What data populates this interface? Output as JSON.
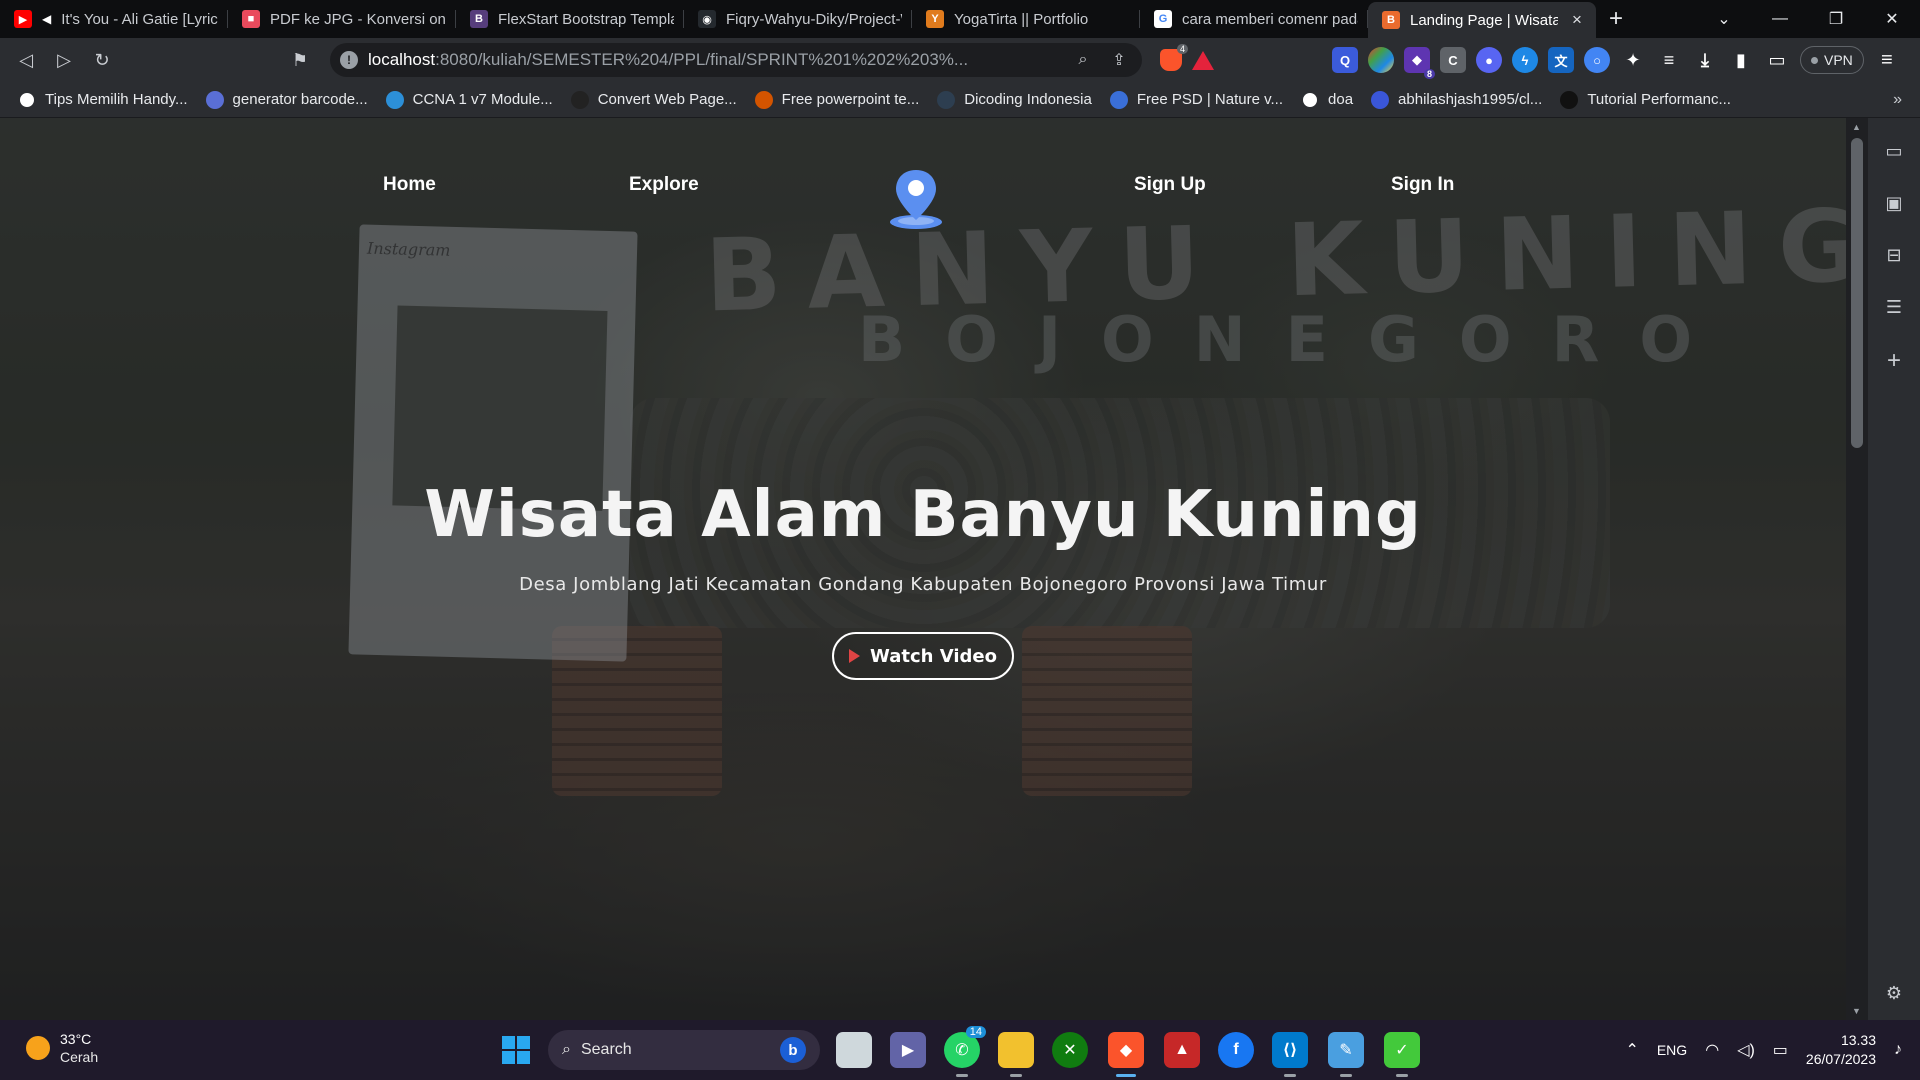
{
  "browser": {
    "tabs": [
      {
        "title": "It's You - Ali Gatie [Lyrics]",
        "favicon_color": "#ff0000",
        "favicon_glyph": "▶",
        "muted": true
      },
      {
        "title": "PDF ke JPG - Konversi online",
        "favicon_color": "#e94a5c",
        "favicon_glyph": "■"
      },
      {
        "title": "FlexStart Bootstrap Template",
        "favicon_color": "#563d7c",
        "favicon_glyph": "B"
      },
      {
        "title": "Fiqry-Wahyu-Diky/Project-W",
        "favicon_color": "#24292e",
        "favicon_glyph": "◉"
      },
      {
        "title": "YogaTirta || Portfolio",
        "favicon_color": "#e07b1d",
        "favicon_glyph": "Y"
      },
      {
        "title": "cara memberi comenr pada",
        "favicon_color": "#ffffff",
        "favicon_glyph": "G"
      },
      {
        "title": "Landing Page | Wisata",
        "favicon_color": "#ea6b2e",
        "favicon_glyph": "B",
        "active": true
      }
    ],
    "url_host": "localhost",
    "url_path": ":8080/kuliah/SEMESTER%204/PPL/final/SPRINT%201%202%203%...",
    "brave_shield_count": "4",
    "extension_badge": "8",
    "vpn_label": "VPN",
    "bookmarks": [
      {
        "label": "Tips Memilih Handy...",
        "color": "#ffffff"
      },
      {
        "label": "generator barcode...",
        "color": "#5a6fd6"
      },
      {
        "label": "CCNA 1 v7 Module...",
        "color": "#2c8fd8"
      },
      {
        "label": "Convert Web Page...",
        "color": "#222222"
      },
      {
        "label": "Free powerpoint te...",
        "color": "#d35400"
      },
      {
        "label": "Dicoding Indonesia",
        "color": "#2d3e50"
      },
      {
        "label": "Free PSD | Nature v...",
        "color": "#3a6fd8"
      },
      {
        "label": "doa",
        "color": "#ffffff"
      },
      {
        "label": "abhilashjash1995/cl...",
        "color": "#3a56d8"
      },
      {
        "label": "Tutorial Performanc...",
        "color": "#111111"
      }
    ]
  },
  "page": {
    "nav": {
      "home": "Home",
      "explore": "Explore",
      "signup": "Sign Up",
      "signin": "Sign In"
    },
    "background_sign": {
      "line1": "BANYU KUNING",
      "line2": "BOJONEGORO",
      "frame_text": "Instagram"
    },
    "hero": {
      "title": "Wisata Alam Banyu Kuning",
      "subtitle": "Desa Jomblang Jati Kecamatan Gondang Kabupaten Bojonegoro Provonsi Jawa Timur",
      "button": "Watch Video"
    },
    "accent_color": "#5b8ff0"
  },
  "taskbar": {
    "weather_temp": "33°C",
    "weather_condition": "Cerah",
    "search_label": "Search",
    "whatsapp_badge": "14",
    "language": "ENG",
    "time": "13.33",
    "date": "26/07/2023"
  }
}
